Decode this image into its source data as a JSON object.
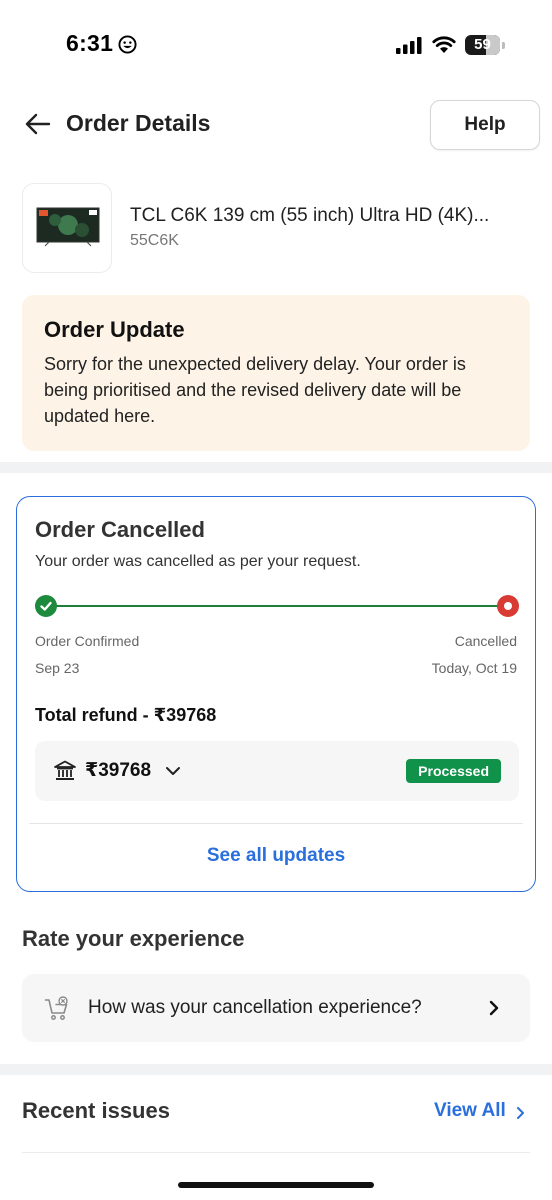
{
  "status_bar": {
    "time": "6:31",
    "battery": "59"
  },
  "header": {
    "title": "Order Details",
    "help_label": "Help"
  },
  "product": {
    "name": "TCL C6K 139 cm (55 inch) Ultra HD (4K)...",
    "model": "55C6K"
  },
  "order_update": {
    "title": "Order Update",
    "message": "Sorry for the unexpected delivery delay. Your order is being prioritised and the revised delivery date will be updated here."
  },
  "cancellation": {
    "title": "Order Cancelled",
    "subtitle": "Your order was cancelled as per your request.",
    "steps": [
      {
        "label": "Order Confirmed",
        "date": "Sep 23"
      },
      {
        "label": "Cancelled",
        "date": "Today, Oct 19"
      }
    ],
    "refund_title": "Total refund - ₹39768",
    "refund_amount": "₹39768",
    "refund_status": "Processed",
    "see_all_label": "See all updates"
  },
  "rate": {
    "title": "Rate your experience",
    "question": "How was your cancellation experience?"
  },
  "recent_issues": {
    "title": "Recent issues",
    "view_all_label": "View All"
  },
  "colors": {
    "accent": "#2a6fdb",
    "success": "#11924a",
    "danger": "#d83a34",
    "notice_bg": "#fdf4e7"
  },
  "icons": [
    "smiley-icon",
    "signal-icon",
    "wifi-icon",
    "battery-icon",
    "back-arrow-icon",
    "bank-icon",
    "chevron-down-icon",
    "cart-cancel-icon",
    "chevron-right-icon"
  ]
}
